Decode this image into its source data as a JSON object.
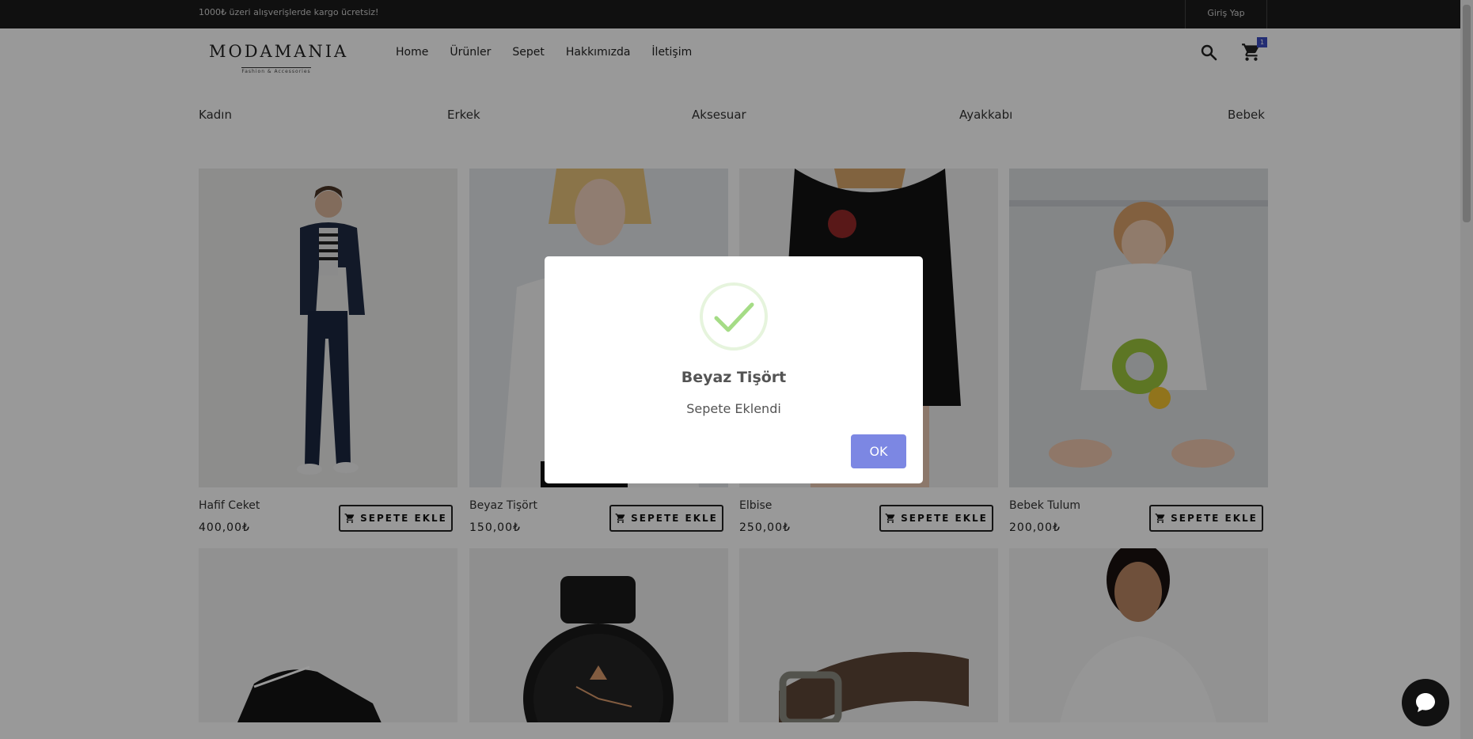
{
  "topbar": {
    "promo": "1000₺ üzeri alışverişlerde kargo ücretsiz!",
    "login": "Giriş Yap"
  },
  "header": {
    "brand": "MODAMANIA",
    "tagline": "Fashion & Accessories",
    "nav": [
      "Home",
      "Ürünler",
      "Sepet",
      "Hakkımızda",
      "İletişim"
    ],
    "cart_count": "1"
  },
  "categories": [
    "Kadın",
    "Erkek",
    "Aksesuar",
    "Ayakkabı",
    "Bebek"
  ],
  "add_label": "SEPETE EKLE",
  "products": [
    {
      "name": "Hafif Ceket",
      "price": "400,00₺"
    },
    {
      "name": "Beyaz Tişört",
      "price": "150,00₺"
    },
    {
      "name": "Elbise",
      "price": "250,00₺"
    },
    {
      "name": "Bebek Tulum",
      "price": "200,00₺"
    }
  ],
  "modal": {
    "title": "Beyaz Tişört",
    "message": "Sepete Eklendi",
    "ok": "OK"
  },
  "colors": {
    "accent": "#7c87e3",
    "success": "#a5dc86",
    "topbar": "#1c1c1c"
  }
}
